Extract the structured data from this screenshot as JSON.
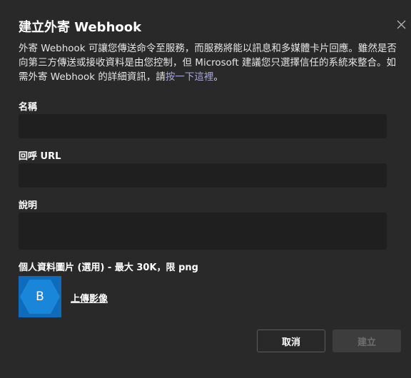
{
  "dialog": {
    "title": "建立外寄 Webhook",
    "description": "外寄 Webhook 可讓您傳送命令至服務，而服務將能以訊息和多媒體卡片回應。雖然是否向第三方傳送或接收資料是由您控制，但 Microsoft 建議您只選擇信任的系統來整合。如需外寄 Webhook 的詳細資訊，請",
    "learn_more_link": "按一下這裡",
    "description_end": "。",
    "close_icon": "close-icon"
  },
  "form": {
    "name_label": "名稱",
    "name_value": "",
    "callback_url_label": "回呼 URL",
    "callback_url_value": "",
    "description_label": "說明",
    "description_value": "",
    "profile_image_label": "個人資料圖片 (選用) - 最大 30K，限 png",
    "avatar_letter": "B",
    "upload_label": "上傳影像"
  },
  "footer": {
    "cancel_label": "取消",
    "create_label": "建立"
  },
  "colors": {
    "background": "#292929",
    "input_background": "#1f1f1f",
    "link": "#a6a7dc",
    "avatar": "#0f6cbd",
    "disabled_button": "#3d3d3d"
  }
}
